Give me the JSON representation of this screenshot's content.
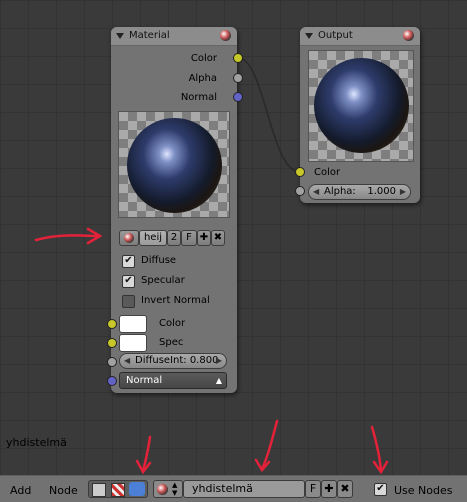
{
  "colors": {
    "annotation_arrow": "#e3223a",
    "wire": "#2a2a2a"
  },
  "material_node": {
    "title": "Material",
    "outputs": [
      "Color",
      "Alpha",
      "Normal"
    ],
    "material_name": "heij",
    "users": "2",
    "fake_user": "F",
    "checkboxes": [
      {
        "label": "Diffuse",
        "checked": true
      },
      {
        "label": "Specular",
        "checked": true
      },
      {
        "label": "Invert Normal",
        "checked": false
      }
    ],
    "inputs": {
      "color": "Color",
      "spec": "Spec"
    },
    "diffuse_intensity": "DiffuseInt: 0.800",
    "normal_select": "Normal"
  },
  "output_node": {
    "title": "Output",
    "input_color": "Color",
    "alpha_label": "Alpha:",
    "alpha_value": "1.000"
  },
  "status_text": "yhdistelmä",
  "header": {
    "menus": [
      "Add",
      "Node"
    ],
    "nodetree_name": "yhdistelmä",
    "fake_user": "F",
    "use_nodes_label": "Use Nodes",
    "use_nodes_checked": true
  }
}
